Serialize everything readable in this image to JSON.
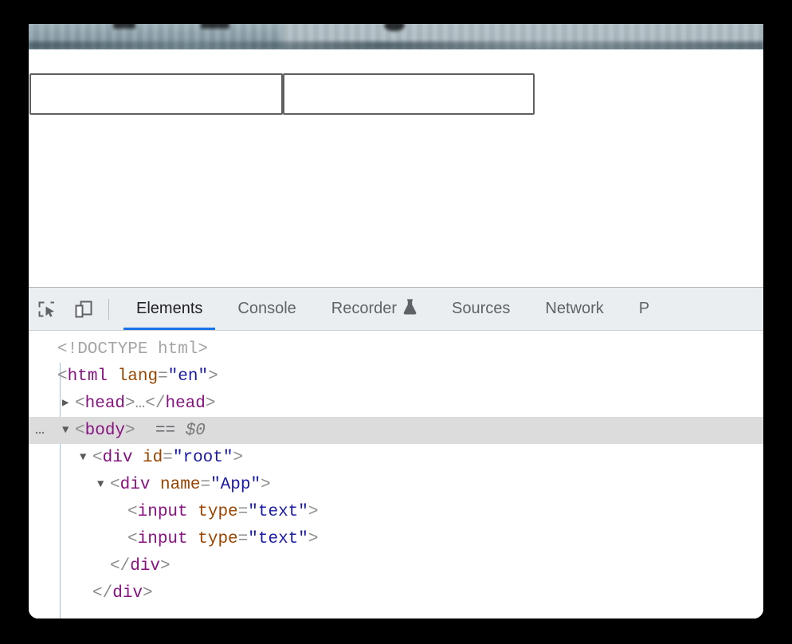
{
  "window": {
    "chrome_strip": "blurred-browser-toolbar"
  },
  "page": {
    "inputs": [
      {
        "name": "first-text-input",
        "type": "text",
        "value": "",
        "placeholder": ""
      },
      {
        "name": "second-text-input",
        "type": "text",
        "value": "",
        "placeholder": ""
      }
    ]
  },
  "devtools": {
    "toolbar": {
      "inspect_icon": "inspect-element-icon",
      "device_icon": "device-toolbar-icon"
    },
    "tabs": [
      {
        "label": "Elements",
        "active": true,
        "icon": ""
      },
      {
        "label": "Console",
        "active": false,
        "icon": ""
      },
      {
        "label": "Recorder",
        "active": false,
        "icon": "flask-icon"
      },
      {
        "label": "Sources",
        "active": false,
        "icon": ""
      },
      {
        "label": "Network",
        "active": false,
        "icon": ""
      },
      {
        "label": "P",
        "active": false,
        "icon": ""
      }
    ],
    "active_tab_accent": "#1a73e8",
    "dom_tree": {
      "rows": [
        {
          "indent": 0,
          "twisty": "",
          "badge": "",
          "selected": false,
          "parts": [
            {
              "cls": "doctype",
              "text": "<!DOCTYPE html>"
            }
          ]
        },
        {
          "indent": 0,
          "twisty": "",
          "badge": "",
          "selected": false,
          "parts": [
            {
              "cls": "punct",
              "text": "<"
            },
            {
              "cls": "tag",
              "text": "html"
            },
            {
              "cls": "plain",
              "text": " "
            },
            {
              "cls": "attr-name",
              "text": "lang"
            },
            {
              "cls": "punct",
              "text": "="
            },
            {
              "cls": "attr-val",
              "text": "\"en\""
            },
            {
              "cls": "punct",
              "text": ">"
            }
          ]
        },
        {
          "indent": 1,
          "twisty": "collapsed",
          "badge": "",
          "selected": false,
          "parts": [
            {
              "cls": "punct",
              "text": "<"
            },
            {
              "cls": "tag",
              "text": "head"
            },
            {
              "cls": "punct",
              "text": ">"
            },
            {
              "cls": "punct",
              "text": "…"
            },
            {
              "cls": "punct",
              "text": "</"
            },
            {
              "cls": "tag",
              "text": "head"
            },
            {
              "cls": "punct",
              "text": ">"
            }
          ]
        },
        {
          "indent": 1,
          "twisty": "expanded",
          "badge": "…",
          "selected": true,
          "parts": [
            {
              "cls": "punct",
              "text": "<"
            },
            {
              "cls": "tag",
              "text": "body"
            },
            {
              "cls": "punct",
              "text": ">"
            },
            {
              "cls": "plain",
              "text": "  "
            },
            {
              "cls": "eq-marker",
              "text": "=="
            },
            {
              "cls": "plain",
              "text": " "
            },
            {
              "cls": "dollar",
              "text": "$0"
            }
          ]
        },
        {
          "indent": 2,
          "twisty": "expanded",
          "badge": "",
          "selected": false,
          "parts": [
            {
              "cls": "punct",
              "text": "<"
            },
            {
              "cls": "tag",
              "text": "div"
            },
            {
              "cls": "plain",
              "text": " "
            },
            {
              "cls": "attr-name",
              "text": "id"
            },
            {
              "cls": "punct",
              "text": "="
            },
            {
              "cls": "attr-val",
              "text": "\"root\""
            },
            {
              "cls": "punct",
              "text": ">"
            }
          ]
        },
        {
          "indent": 3,
          "twisty": "expanded",
          "badge": "",
          "selected": false,
          "parts": [
            {
              "cls": "punct",
              "text": "<"
            },
            {
              "cls": "tag",
              "text": "div"
            },
            {
              "cls": "plain",
              "text": " "
            },
            {
              "cls": "attr-name",
              "text": "name"
            },
            {
              "cls": "punct",
              "text": "="
            },
            {
              "cls": "attr-val",
              "text": "\"App\""
            },
            {
              "cls": "punct",
              "text": ">"
            }
          ]
        },
        {
          "indent": 4,
          "twisty": "",
          "badge": "",
          "selected": false,
          "parts": [
            {
              "cls": "punct",
              "text": "<"
            },
            {
              "cls": "tag",
              "text": "input"
            },
            {
              "cls": "plain",
              "text": " "
            },
            {
              "cls": "attr-name",
              "text": "type"
            },
            {
              "cls": "punct",
              "text": "="
            },
            {
              "cls": "attr-val",
              "text": "\"text\""
            },
            {
              "cls": "punct",
              "text": ">"
            }
          ]
        },
        {
          "indent": 4,
          "twisty": "",
          "badge": "",
          "selected": false,
          "parts": [
            {
              "cls": "punct",
              "text": "<"
            },
            {
              "cls": "tag",
              "text": "input"
            },
            {
              "cls": "plain",
              "text": " "
            },
            {
              "cls": "attr-name",
              "text": "type"
            },
            {
              "cls": "punct",
              "text": "="
            },
            {
              "cls": "attr-val",
              "text": "\"text\""
            },
            {
              "cls": "punct",
              "text": ">"
            }
          ]
        },
        {
          "indent": 3,
          "twisty": "",
          "badge": "",
          "selected": false,
          "parts": [
            {
              "cls": "punct",
              "text": "</"
            },
            {
              "cls": "tag",
              "text": "div"
            },
            {
              "cls": "punct",
              "text": ">"
            }
          ]
        },
        {
          "indent": 2,
          "twisty": "",
          "badge": "",
          "selected": false,
          "parts": [
            {
              "cls": "punct",
              "text": "</"
            },
            {
              "cls": "tag",
              "text": "div"
            },
            {
              "cls": "punct",
              "text": ">"
            }
          ]
        }
      ]
    }
  }
}
